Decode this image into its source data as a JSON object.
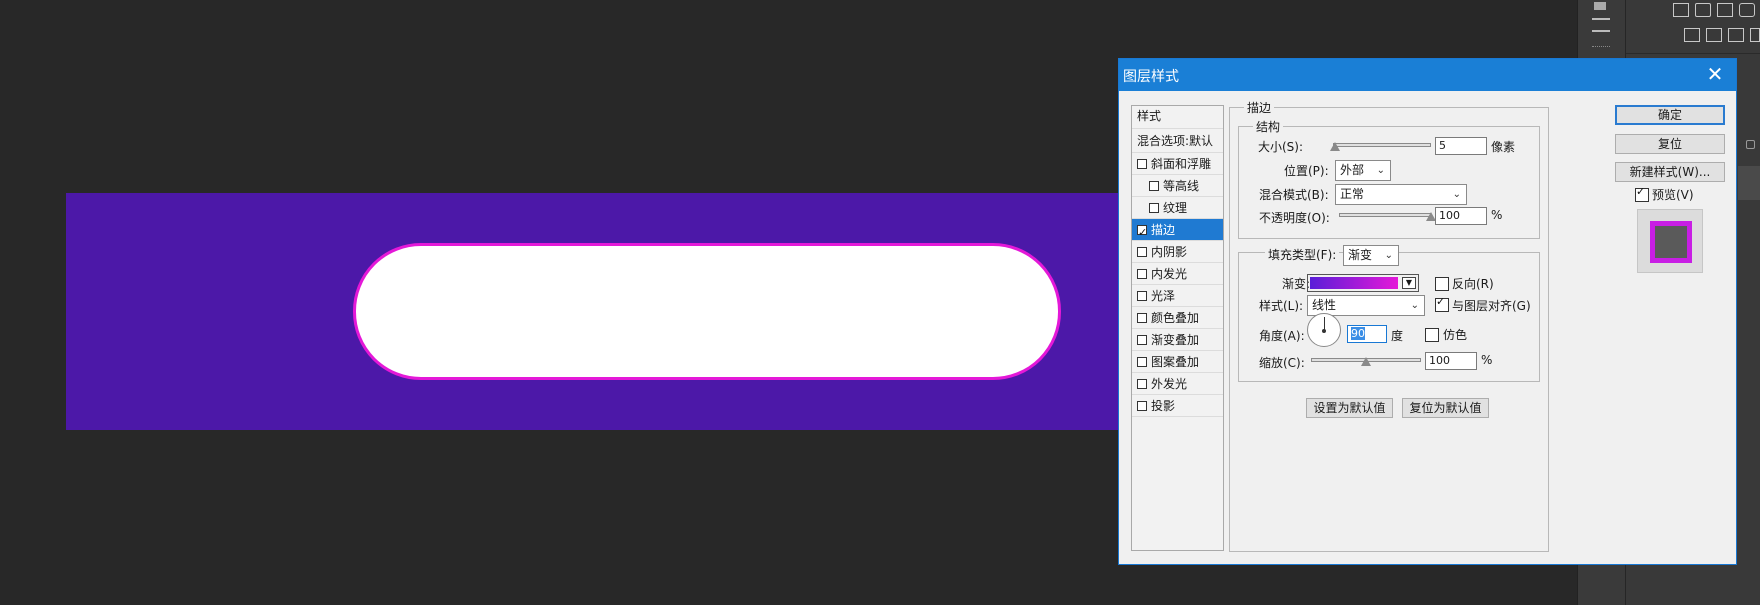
{
  "colors": {
    "canvas_bg": "#282828",
    "banner": "#4c18a8",
    "stroke_gradient_start": "#5a1ed8",
    "stroke_gradient_end": "#e418d8",
    "titlebar": "#1a7fd6",
    "selected_row": "#1f7ad2"
  },
  "dialog": {
    "title": "图层样式",
    "close_label": "✕"
  },
  "style_list": {
    "header": "样式",
    "blend_options": "混合选项:默认",
    "items": [
      {
        "label": "斜面和浮雕",
        "checked": false,
        "indent": false,
        "selected": false
      },
      {
        "label": "等高线",
        "checked": false,
        "indent": true,
        "selected": false
      },
      {
        "label": "纹理",
        "checked": false,
        "indent": true,
        "selected": false
      },
      {
        "label": "描边",
        "checked": true,
        "indent": false,
        "selected": true
      },
      {
        "label": "内阴影",
        "checked": false,
        "indent": false,
        "selected": false
      },
      {
        "label": "内发光",
        "checked": false,
        "indent": false,
        "selected": false
      },
      {
        "label": "光泽",
        "checked": false,
        "indent": false,
        "selected": false
      },
      {
        "label": "颜色叠加",
        "checked": false,
        "indent": false,
        "selected": false
      },
      {
        "label": "渐变叠加",
        "checked": false,
        "indent": false,
        "selected": false
      },
      {
        "label": "图案叠加",
        "checked": false,
        "indent": false,
        "selected": false
      },
      {
        "label": "外发光",
        "checked": false,
        "indent": false,
        "selected": false
      },
      {
        "label": "投影",
        "checked": false,
        "indent": false,
        "selected": false
      }
    ]
  },
  "stroke": {
    "section_title": "描边",
    "structure_title": "结构",
    "size_label": "大小(S):",
    "size_value": "5",
    "size_unit": "像素",
    "size_fraction": 0.02,
    "position_label": "位置(P):",
    "position_value": "外部",
    "blend_label": "混合模式(B):",
    "blend_value": "正常",
    "opacity_label": "不透明度(O):",
    "opacity_value": "100",
    "opacity_unit": "%",
    "opacity_fraction": 1.0,
    "fill_type_label": "填充类型(F):",
    "fill_type_value": "渐变",
    "gradient_label": "渐变:",
    "reverse_label": "反向(R)",
    "reverse_checked": false,
    "style_label": "样式(L):",
    "style_value": "线性",
    "align_label": "与图层对齐(G)",
    "align_checked": true,
    "angle_label": "角度(A):",
    "angle_value": "90",
    "angle_unit": "度",
    "dither_label": "仿色",
    "dither_checked": false,
    "scale_label": "缩放(C):",
    "scale_value": "100",
    "scale_unit": "%",
    "scale_fraction": 0.5,
    "set_default_label": "设置为默认值",
    "reset_default_label": "复位为默认值"
  },
  "buttons": {
    "ok": "确定",
    "reset": "复位",
    "new_style": "新建样式(W)...",
    "preview_label": "预览(V)",
    "preview_checked": true
  }
}
